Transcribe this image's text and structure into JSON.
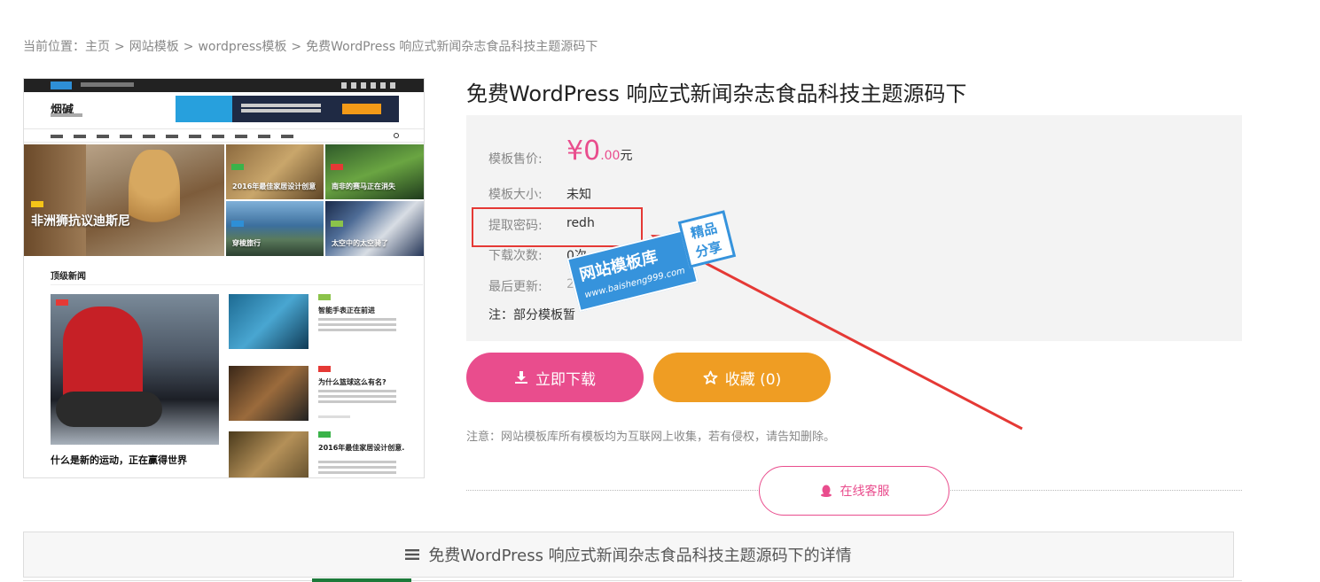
{
  "breadcrumb": {
    "prefix": "当前位置：",
    "items": [
      "主页",
      "网站模板",
      "wordpress模板",
      "免费WordPress 响应式新闻杂志食品科技主题源码下"
    ],
    "separator": ">"
  },
  "preview": {
    "logo": "烟碱",
    "hero_title": "非洲狮抗议迪斯尼",
    "tiles": [
      {
        "title": "2016年最佳家居设计创意"
      },
      {
        "title": "南非的赛马正在消失"
      },
      {
        "title": "穿梭旅行"
      },
      {
        "title": "太空中的太空骑了"
      }
    ],
    "section_title": "顶级新闻",
    "big_title": "什么是新的运动，正在赢得世界",
    "side_items": [
      {
        "title": "智能手表正在前进"
      },
      {
        "title": "为什么篮球这么有名?"
      },
      {
        "title": "2016年最佳家居设计创意."
      }
    ]
  },
  "product": {
    "title": "免费WordPress 响应式新闻杂志食品科技主题源码下",
    "price_label": "模板售价:",
    "price_symbol": "¥",
    "price_int": "0",
    "price_dec": ".00",
    "price_unit": "元",
    "size_label": "模板大小:",
    "size_value": "未知",
    "password_label": "提取密码:",
    "password_value": "redh",
    "downloads_label": "下载次数:",
    "downloads_value": "0次",
    "updated_label": "最后更新:",
    "updated_value": "2020-06",
    "note": "注：部分模板暂"
  },
  "watermark": {
    "title": "网站模板库",
    "url": "www.baisheng999.com",
    "badge_line1": "精品",
    "badge_line2": "分享"
  },
  "actions": {
    "download_label": "立即下载",
    "favorite_label": "收藏 (0)",
    "notice": "注意：网站模板库所有模板均为互联网上收集，若有侵权，请告知删除。",
    "service_label": "在线客服"
  },
  "detail": {
    "title": "免费WordPress 响应式新闻杂志食品科技主题源码下的详情"
  },
  "colors": {
    "accent_pink": "#e94d8d",
    "accent_orange": "#ef9d23",
    "highlight_red": "#e53935",
    "watermark_blue": "#3693dc"
  }
}
